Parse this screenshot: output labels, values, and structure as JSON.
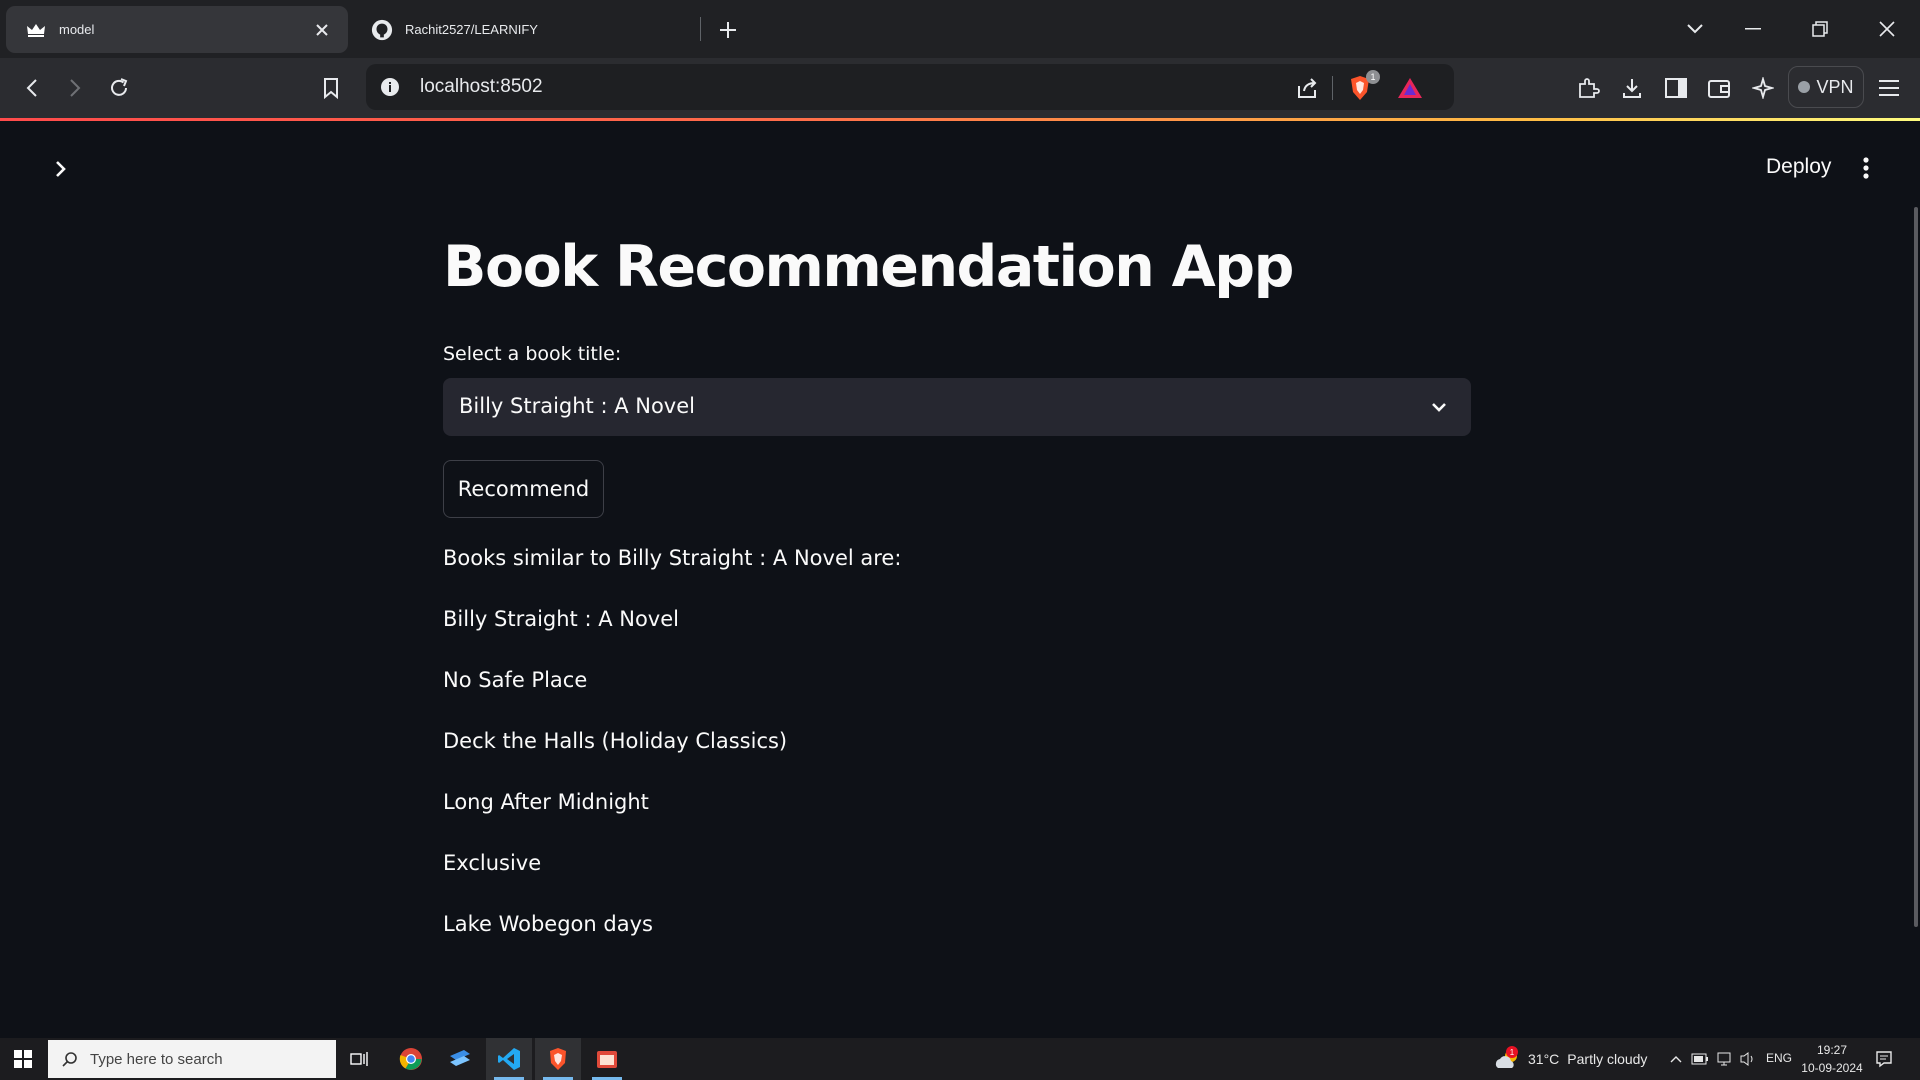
{
  "browser": {
    "tabs": [
      {
        "title": "model",
        "active": true,
        "favicon": "streamlit-crown-icon"
      },
      {
        "title": "Rachit2527/LEARNIFY",
        "active": false,
        "favicon": "github-icon"
      }
    ],
    "url": "localhost:8502",
    "shields_count": "1",
    "vpn_label": "VPN"
  },
  "app": {
    "deploy_label": "Deploy",
    "title": "Book Recommendation App",
    "select_label": "Select a book title:",
    "selected_book": "Billy Straight : A Novel",
    "button_label": "Recommend",
    "result_heading": "Books similar to Billy Straight : A Novel are:",
    "recommendations": [
      "Billy Straight : A Novel",
      "No Safe Place",
      "Deck the Halls (Holiday Classics)",
      "Long After Midnight",
      "Exclusive",
      "Lake Wobegon days"
    ]
  },
  "taskbar": {
    "search_placeholder": "Type here to search",
    "weather": {
      "temp": "31°C",
      "condition": "Partly cloudy",
      "alert_count": "1"
    },
    "language": "ENG",
    "time": "19:27",
    "date": "10-09-2024"
  },
  "colors": {
    "app_background": "#0e1117",
    "select_background": "#262730",
    "accent_red": "#ff4b4b"
  }
}
